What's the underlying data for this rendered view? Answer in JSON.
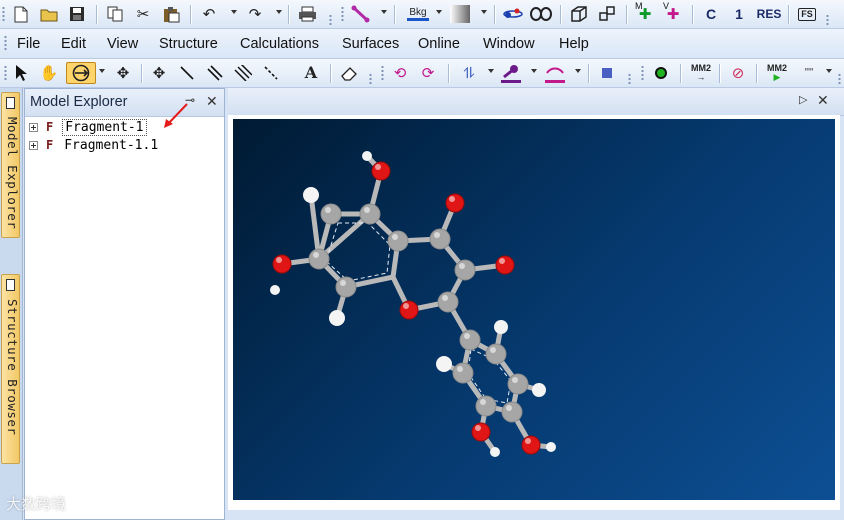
{
  "toolbar1": {
    "icons": [
      "new-file",
      "open-folder",
      "save",
      "copy",
      "cut",
      "paste",
      "undo",
      "redo",
      "print",
      "bond-tool",
      "background",
      "gradient",
      "orbital",
      "ring",
      "cube",
      "cube-pair",
      "move-h",
      "move-v",
      "c-label",
      "one-label",
      "res-label",
      "fragment"
    ],
    "labels": {
      "bkg": "Bkg",
      "mm": "M",
      "vv": "V",
      "c": "C",
      "one": "1",
      "res": "RES",
      "fs": "FS"
    }
  },
  "menu": [
    "File",
    "Edit",
    "View",
    "Structure",
    "Calculations",
    "Surfaces",
    "Online",
    "Window",
    "Help"
  ],
  "toolbar2": {
    "labels": {
      "text_tool": "A",
      "mm2_a": "MM2",
      "mm2_b": "MM2"
    }
  },
  "side_tabs": [
    "Model Explorer",
    "Structure Browser"
  ],
  "explorer": {
    "title": "Model Explorer",
    "items": [
      {
        "label": "Fragment-1",
        "prefix": "F",
        "selected": true
      },
      {
        "label": "Fragment-1.1",
        "prefix": "F",
        "selected": false
      }
    ]
  },
  "watermark": "大数跨境",
  "colors": {
    "accent": "#ffd46a",
    "canvas_dark": "#001a33",
    "canvas_light": "#0d4f94",
    "oxygen": "#e01515",
    "carbon": "#a8a8a8",
    "hydrogen": "#ffffff",
    "arrow": "#e51c1c"
  }
}
